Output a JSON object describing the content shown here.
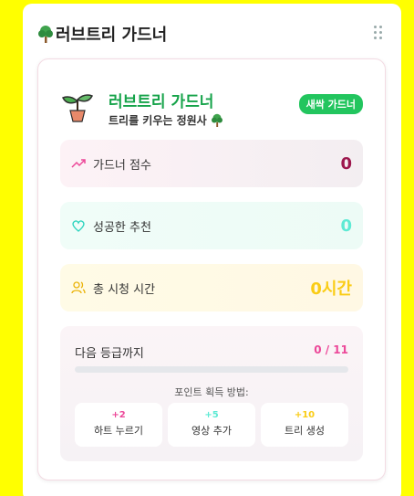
{
  "panel": {
    "title": "러브트리 가드너"
  },
  "card": {
    "title": "러브트리 가드너",
    "subtitle": "트리를 키우는 정원사",
    "badge": "새싹 가드너"
  },
  "stats": [
    {
      "label": "가드너 점수",
      "value": "0",
      "color": "#9d174d",
      "icon": "trending-up-icon"
    },
    {
      "label": "성공한 추천",
      "value": "0",
      "color": "#5eead4",
      "icon": "heart-icon"
    },
    {
      "label": "총 시청 시간",
      "value": "0시간",
      "color": "#facc15",
      "icon": "users-icon"
    }
  ],
  "level": {
    "title": "다음 등급까지",
    "value": "0 / 11",
    "progress": 0,
    "how": "포인트 획득 방법:",
    "tips": [
      {
        "points": "+2",
        "action": "하트 누르기",
        "color": "#ec4899"
      },
      {
        "points": "+5",
        "action": "영상 추가",
        "color": "#5eead4"
      },
      {
        "points": "+10",
        "action": "트리 생성",
        "color": "#facc15"
      }
    ]
  },
  "colors": {
    "green": "#16a34a",
    "pink": "#ec4899",
    "yellow_bg": "#FFFF00"
  }
}
